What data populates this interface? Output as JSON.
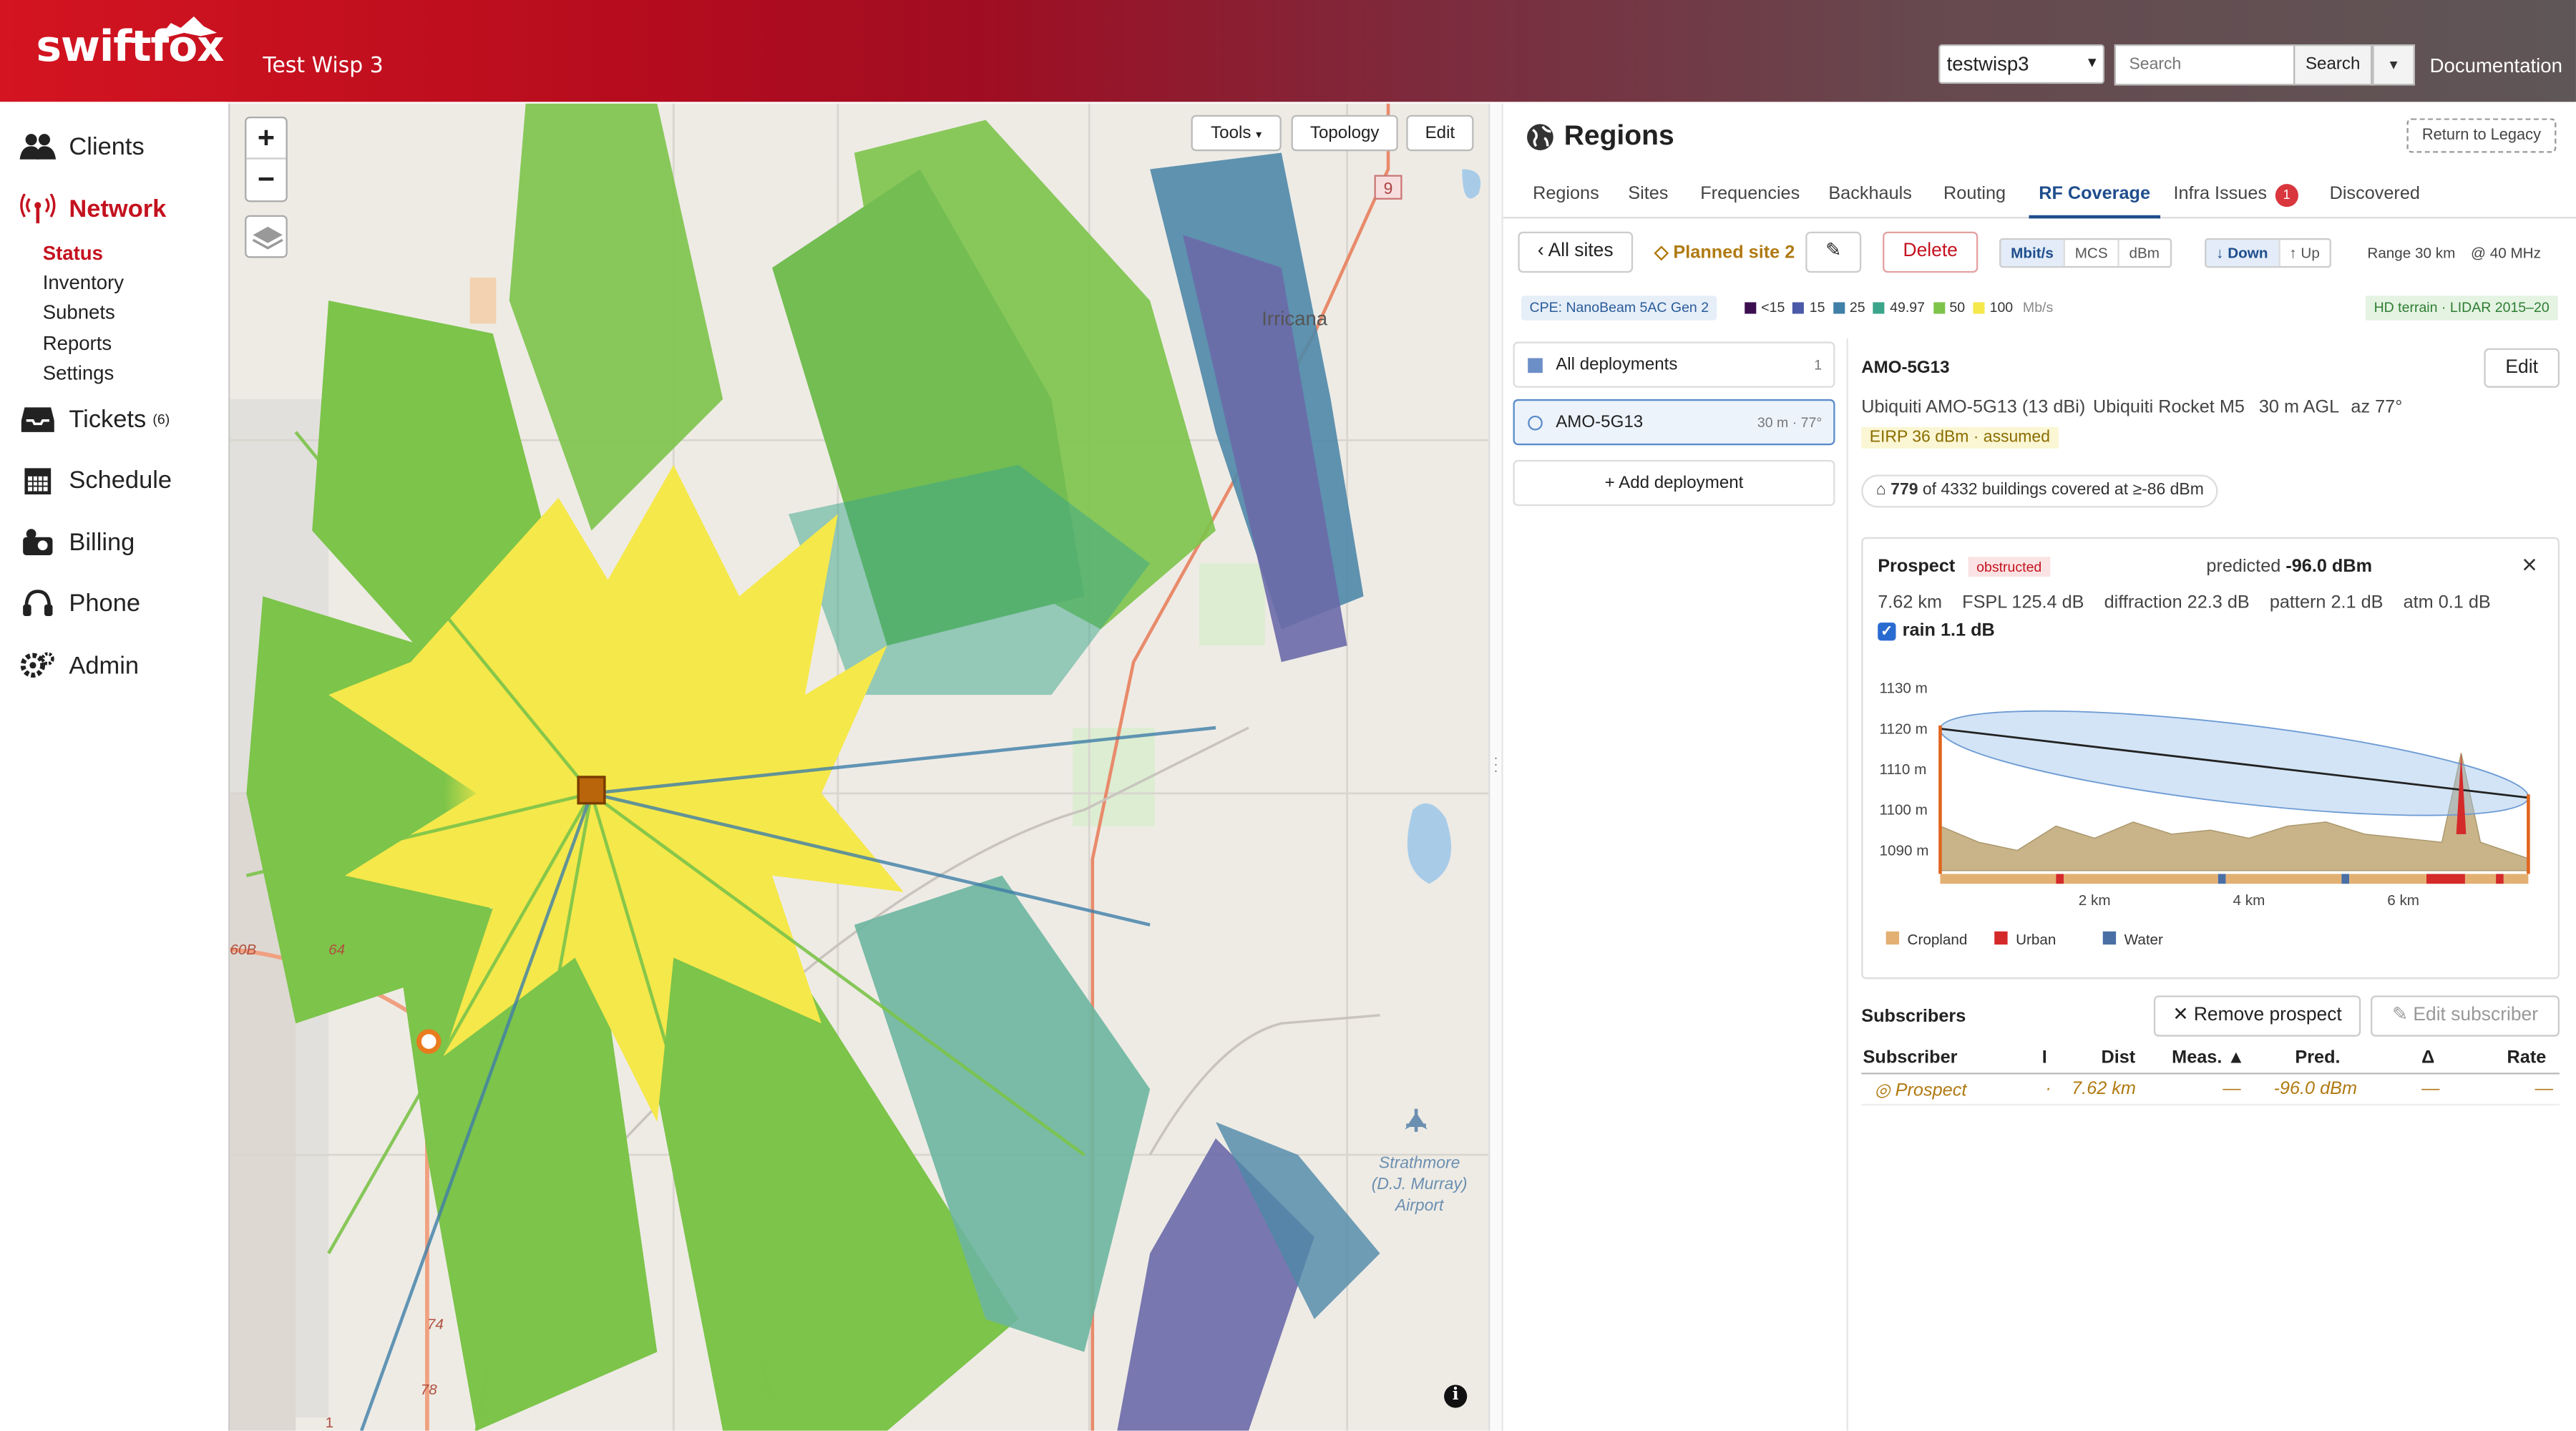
{
  "header": {
    "brand": "swiftfox",
    "instance": "Test Wisp 3",
    "org_select": "testwisp3",
    "search_placeholder": "Search",
    "search_button": "Search",
    "docs_link": "Documentation"
  },
  "sidebar": {
    "items": [
      {
        "label": "Clients",
        "icon": "users-icon"
      },
      {
        "label": "Network",
        "icon": "antenna-icon",
        "active": true
      },
      {
        "label": "Tickets",
        "icon": "inbox-icon",
        "badge": "(6)"
      },
      {
        "label": "Schedule",
        "icon": "calendar-icon"
      },
      {
        "label": "Billing",
        "icon": "billing-icon"
      },
      {
        "label": "Phone",
        "icon": "headset-icon"
      },
      {
        "label": "Admin",
        "icon": "gears-icon"
      }
    ],
    "network_sub": [
      "Status",
      "Inventory",
      "Subnets",
      "Reports",
      "Settings"
    ]
  },
  "map": {
    "tools": "Tools",
    "topology": "Topology",
    "edit": "Edit",
    "zoom_in": "+",
    "zoom_out": "−",
    "place_irricana": "Irricana",
    "airport_l1": "Strathmore",
    "airport_l2": "(D.J. Murray)",
    "airport_l3": "Airport",
    "road_9": "9",
    "road_64": "64",
    "road_60b": "60B",
    "road_74": "74",
    "road_78": "78",
    "road_1": "1",
    "info": "i"
  },
  "panel": {
    "title": "Regions",
    "return_legacy": "Return to Legacy",
    "tabs": [
      {
        "label": "Regions"
      },
      {
        "label": "Sites"
      },
      {
        "label": "Frequencies"
      },
      {
        "label": "Backhauls"
      },
      {
        "label": "Routing"
      },
      {
        "label": "RF Coverage",
        "active": true
      },
      {
        "label": "Infra Issues",
        "count": "1"
      },
      {
        "label": "Discovered"
      }
    ],
    "all_sites": "‹ All sites",
    "planned_site": "◇ Planned site 2",
    "pencil": "✎",
    "delete": "Delete",
    "units": [
      "Mbit/s",
      "MCS",
      "dBm"
    ],
    "direction": [
      "↓ Down",
      "↑ Up"
    ],
    "range": "Range 30 km",
    "bandwidth": "@ 40 MHz",
    "cpe": "CPE: NanoBeam 5AC Gen 2",
    "legend": [
      {
        "label": "<15",
        "color": "#3b0f4f"
      },
      {
        "label": "15",
        "color": "#4a5aa8"
      },
      {
        "label": "25",
        "color": "#3f7fa8"
      },
      {
        "label": "49.97",
        "color": "#3aa58a"
      },
      {
        "label": "50",
        "color": "#7cc44a"
      },
      {
        "label": "100",
        "color": "#f5e84a"
      }
    ],
    "legend_unit": "Mb/s",
    "hd_terrain": "HD terrain · LIDAR 2015–20",
    "deployments": {
      "all": "All deployments",
      "all_count": "1",
      "selected": "AMO-5G13",
      "selected_meta": "30 m · 77°",
      "add": "+ Add deployment"
    },
    "detail": {
      "name": "AMO-5G13",
      "edit": "Edit",
      "antenna": "Ubiquiti AMO-5G13 (13 dBi)",
      "radio": "Ubiquiti Rocket M5",
      "agl": "30 m AGL",
      "az": "az 77°",
      "eirp": "EIRP 36 dBm · assumed",
      "buildings_n": "779",
      "buildings_rest": "of 4332 buildings covered at ≥-86 dBm"
    },
    "prospect": {
      "title": "Prospect",
      "status": "obstructed",
      "predicted_label": "predicted",
      "predicted_value": "-96.0 dBm",
      "close": "×",
      "dist": "7.62 km",
      "fspl": "FSPL 125.4 dB",
      "diffraction": "diffraction 22.3 dB",
      "pattern": "pattern 2.1 dB",
      "atm": "atm 0.1 dB",
      "rain": "rain 1.1 dB"
    },
    "subscribers": {
      "title": "Subscribers",
      "remove": "Remove prospect",
      "edit": "✎ Edit subscriber",
      "columns": [
        "Subscriber",
        "I",
        "Dist",
        "Meas. ▲",
        "Pred.",
        "Δ",
        "Rate"
      ],
      "row": [
        "◎ Prospect",
        "·",
        "7.62 km",
        "—",
        "-96.0 dBm",
        "—",
        "—"
      ]
    }
  },
  "chart_data": {
    "type": "area",
    "title": "",
    "xlabel": "",
    "ylabel": "",
    "x_ticks": [
      "2 km",
      "4 km",
      "6 km"
    ],
    "y_ticks": [
      "1090 m",
      "1100 m",
      "1110 m",
      "1120 m",
      "1130 m"
    ],
    "xlim": [
      0,
      7.62
    ],
    "ylim": [
      1085,
      1132
    ],
    "series": [
      {
        "x": [
          0,
          0.5,
          1,
          1.5,
          2,
          2.5,
          3,
          3.5,
          4,
          4.5,
          5,
          5.5,
          6,
          6.5,
          6.75,
          7,
          7.62
        ],
        "values": [
          1096,
          1092,
          1090,
          1096,
          1093,
          1097,
          1094,
          1095,
          1093,
          1096,
          1097,
          1094,
          1093,
          1092,
          1114,
          1092,
          1088
        ]
      }
    ],
    "los_line": {
      "from": [
        0,
        1120
      ],
      "to": [
        7.62,
        1103
      ]
    },
    "legend": [
      {
        "label": "Cropland",
        "color": "#e3b073"
      },
      {
        "label": "Urban",
        "color": "#d42a2a"
      },
      {
        "label": "Water",
        "color": "#4a6fa5"
      }
    ]
  }
}
